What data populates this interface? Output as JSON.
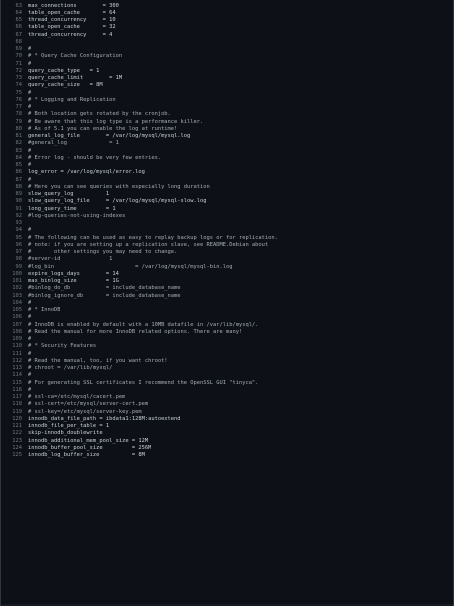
{
  "lines": [
    {
      "n": "63",
      "t": "max_connections        = 300"
    },
    {
      "n": "64",
      "t": "table_open_cache       = 64"
    },
    {
      "n": "65",
      "t": "thread_concurrency     = 10"
    },
    {
      "n": "66",
      "t": "table_open_cache       = 32"
    },
    {
      "n": "67",
      "t": "thread_concurrency     = 4"
    },
    {
      "n": "68",
      "t": ""
    },
    {
      "n": "69",
      "t": "#"
    },
    {
      "n": "70",
      "t": "# * Query Cache Configuration"
    },
    {
      "n": "71",
      "t": "#"
    },
    {
      "n": "72",
      "t": "query_cache_type   = 1"
    },
    {
      "n": "73",
      "t": "query_cache_limit        = 1M"
    },
    {
      "n": "74",
      "t": "query_cache_size   = 8M"
    },
    {
      "n": "75",
      "t": "#"
    },
    {
      "n": "76",
      "t": "# * Logging and Replication"
    },
    {
      "n": "77",
      "t": "#"
    },
    {
      "n": "78",
      "t": "# Both location gets rotated by the cronjob."
    },
    {
      "n": "79",
      "t": "# Be aware that this log type is a performance killer."
    },
    {
      "n": "80",
      "t": "# As of 5.1 you can enable the log at runtime!"
    },
    {
      "n": "81",
      "t": "general_log_file        = /var/log/mysql/mysql.log"
    },
    {
      "n": "82",
      "t": "#general_log             = 1"
    },
    {
      "n": "83",
      "t": "#"
    },
    {
      "n": "84",
      "t": "# Error log - should be very few entries."
    },
    {
      "n": "85",
      "t": "#"
    },
    {
      "n": "86",
      "t": "log_error = /var/log/mysql/error.log"
    },
    {
      "n": "87",
      "t": "#"
    },
    {
      "n": "88",
      "t": "# Here you can see queries with especially long duration"
    },
    {
      "n": "89",
      "t": "slow_query_log          1"
    },
    {
      "n": "90",
      "t": "slow_query_log_file     = /var/log/mysql/mysql-slow.log"
    },
    {
      "n": "91",
      "t": "long_query_time         = 1"
    },
    {
      "n": "92",
      "t": "#log-queries-not-using-indexes"
    },
    {
      "n": "93",
      "t": ""
    },
    {
      "n": "94",
      "t": "#"
    },
    {
      "n": "95",
      "t": "# The following can be used as easy to replay backup logs or for replication."
    },
    {
      "n": "96",
      "t": "# note: if you are setting up a replication slave, see README.Debian about"
    },
    {
      "n": "97",
      "t": "#       other settings you may need to change."
    },
    {
      "n": "98",
      "t": "#server-id               1"
    },
    {
      "n": "99",
      "t": "#log_bin                         = /var/log/mysql/mysql-bin.log"
    },
    {
      "n": "100",
      "t": "expire_logs_days        = 14"
    },
    {
      "n": "101",
      "t": "max_binlog_size         = 1G"
    },
    {
      "n": "102",
      "t": "#binlog_do_db           = include_database_name"
    },
    {
      "n": "103",
      "t": "#binlog_ignore_db       = include_database_name"
    },
    {
      "n": "104",
      "t": "#"
    },
    {
      "n": "105",
      "t": "# * InnoDB"
    },
    {
      "n": "106",
      "t": "#"
    },
    {
      "n": "107",
      "t": "# InnoDB is enabled by default with a 10MB datafile in /var/lib/mysql/."
    },
    {
      "n": "108",
      "t": "# Read the manual for more InnoDB related options. There are many!"
    },
    {
      "n": "109",
      "t": "#"
    },
    {
      "n": "110",
      "t": "# * Security Features"
    },
    {
      "n": "111",
      "t": "#"
    },
    {
      "n": "112",
      "t": "# Read the manual, too, if you want chroot!"
    },
    {
      "n": "113",
      "t": "# chroot = /var/lib/mysql/"
    },
    {
      "n": "114",
      "t": "#"
    },
    {
      "n": "115",
      "t": "# For generating SSL certificates I recommend the OpenSSL GUI \"tinyca\"."
    },
    {
      "n": "116",
      "t": "#"
    },
    {
      "n": "117",
      "t": "# ssl-ca=/etc/mysql/cacert.pem"
    },
    {
      "n": "118",
      "t": "# ssl-cert=/etc/mysql/server-cert.pem"
    },
    {
      "n": "119",
      "t": "# ssl-key=/etc/mysql/server-key.pem"
    },
    {
      "n": "120",
      "t": "innodb_data_file_path = ibdata1:128M:autoextend"
    },
    {
      "n": "121",
      "t": "innodb_file_per_table = 1"
    },
    {
      "n": "122",
      "t": "skip-innodb_doublewrite"
    },
    {
      "n": "123",
      "t": "innodb_additional_mem_pool_size = 12M"
    },
    {
      "n": "124",
      "t": "innodb_buffer_pool_size         = 256M"
    },
    {
      "n": "125",
      "t": "innodb_log_buffer_size          = 8M"
    }
  ]
}
